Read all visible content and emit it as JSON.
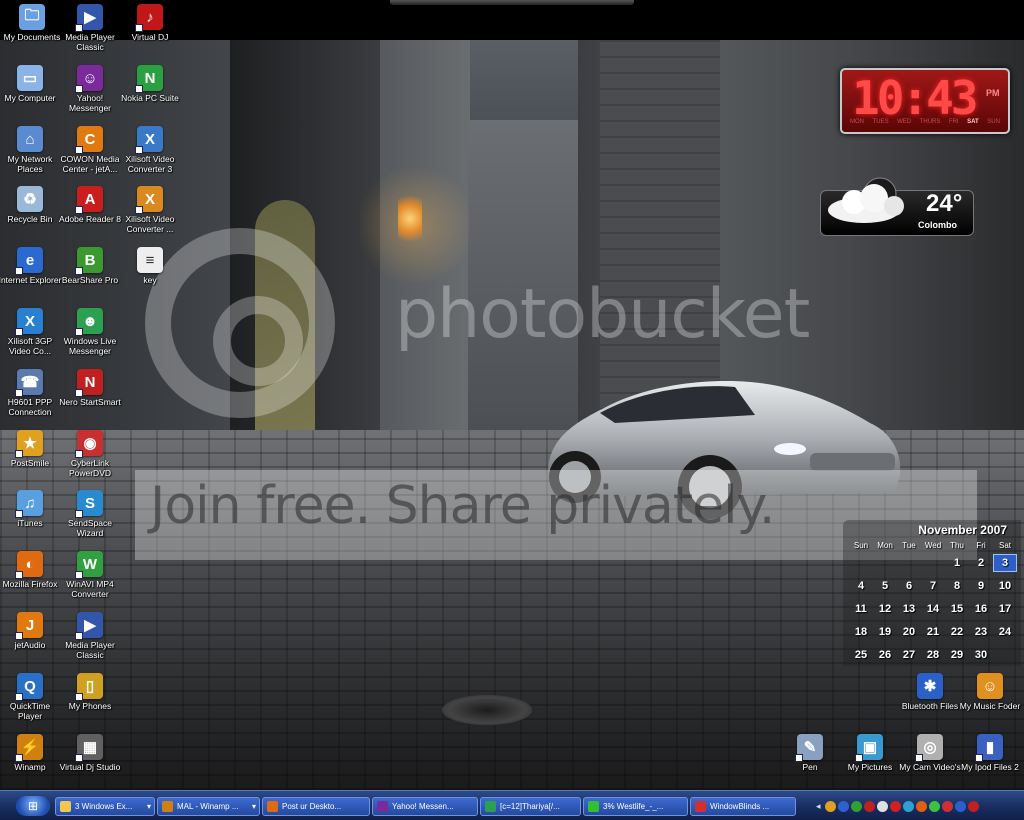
{
  "desktop_icons": [
    {
      "id": "my-documents",
      "label": "My Documents",
      "glyph": "🗀",
      "color": "#6aa0e0"
    },
    {
      "id": "media-player-classic-1",
      "label": "Media Player Classic",
      "glyph": "▶",
      "color": "#3355aa"
    },
    {
      "id": "virtual-dj",
      "label": "Virtual DJ",
      "glyph": "♪",
      "color": "#c01818"
    },
    {
      "id": "my-computer",
      "label": "My Computer",
      "glyph": "▭",
      "color": "#8ab4e8"
    },
    {
      "id": "yahoo-messenger",
      "label": "Yahoo! Messenger",
      "glyph": "☺",
      "color": "#7a2a9a"
    },
    {
      "id": "nokia-pc-suite",
      "label": "Nokia PC Suite",
      "glyph": "N",
      "color": "#2aa040"
    },
    {
      "id": "my-network-places",
      "label": "My Network Places",
      "glyph": "⌂",
      "color": "#5a8ad0"
    },
    {
      "id": "cowon-media-center",
      "label": "COWON Media Center - jetA...",
      "glyph": "C",
      "color": "#e07a10"
    },
    {
      "id": "xilisoft-video-converter-3",
      "label": "Xilisoft Video Converter 3",
      "glyph": "X",
      "color": "#3a78c8"
    },
    {
      "id": "recycle-bin",
      "label": "Recycle Bin",
      "glyph": "♻",
      "color": "#9ab8d8"
    },
    {
      "id": "adobe-reader-8",
      "label": "Adobe Reader 8",
      "glyph": "A",
      "color": "#c81e1e"
    },
    {
      "id": "xilisoft-video-converter",
      "label": "Xilisoft Video Converter ...",
      "glyph": "X",
      "color": "#d88a20"
    },
    {
      "id": "internet-explorer",
      "label": "Internet Explorer",
      "glyph": "e",
      "color": "#2a6ad0"
    },
    {
      "id": "bearshare-pro",
      "label": "BearShare Pro",
      "glyph": "B",
      "color": "#3a9a30"
    },
    {
      "id": "key",
      "label": "key",
      "glyph": "≡",
      "color": "#eeeeee"
    },
    {
      "id": "xilisoft-3gp",
      "label": "Xilisoft 3GP Video Co...",
      "glyph": "X",
      "color": "#2a80d0"
    },
    {
      "id": "windows-live-messenger",
      "label": "Windows Live Messenger",
      "glyph": "☻",
      "color": "#2aa050"
    },
    {
      "id": "h9601-ppp",
      "label": "H9601 PPP Connection",
      "glyph": "☎",
      "color": "#5a7ab0"
    },
    {
      "id": "nero-startsmart",
      "label": "Nero StartSmart",
      "glyph": "N",
      "color": "#c02020"
    },
    {
      "id": "postsmile",
      "label": "PostSmile",
      "glyph": "★",
      "color": "#e0a020"
    },
    {
      "id": "cyberlink-powerdvd",
      "label": "CyberLink PowerDVD",
      "glyph": "◉",
      "color": "#c83030"
    },
    {
      "id": "itunes",
      "label": "iTunes",
      "glyph": "♫",
      "color": "#5aa0e0"
    },
    {
      "id": "sendspace-wizard",
      "label": "SendSpace Wizard",
      "glyph": "S",
      "color": "#2a8ad0"
    },
    {
      "id": "mozilla-firefox",
      "label": "Mozilla Firefox",
      "glyph": "◐",
      "color": "#e06a10"
    },
    {
      "id": "winavi-mp4",
      "label": "WinAVI MP4 Converter",
      "glyph": "W",
      "color": "#30a040"
    },
    {
      "id": "jetaudio",
      "label": "jetAudio",
      "glyph": "J",
      "color": "#e07a10"
    },
    {
      "id": "media-player-classic-2",
      "label": "Media Player Classic",
      "glyph": "▶",
      "color": "#3355aa"
    },
    {
      "id": "quicktime-player",
      "label": "QuickTime Player",
      "glyph": "Q",
      "color": "#2a70c8"
    },
    {
      "id": "my-phones",
      "label": "My Phones",
      "glyph": "▯",
      "color": "#d0a020"
    },
    {
      "id": "winamp",
      "label": "Winamp",
      "glyph": "⚡",
      "color": "#d08010"
    },
    {
      "id": "virtual-dj-studio",
      "label": "Virtual Dj Studio",
      "glyph": "▦",
      "color": "#606060"
    },
    {
      "id": "bluetooth-files",
      "label": "Bluetooth Files",
      "glyph": "✱",
      "color": "#2a60c8"
    },
    {
      "id": "my-music-foder",
      "label": "My Music Foder",
      "glyph": "☺",
      "color": "#e09020"
    },
    {
      "id": "pen",
      "label": "Pen",
      "glyph": "✎",
      "color": "#8aa0c0"
    },
    {
      "id": "my-pictures",
      "label": "My Pictures",
      "glyph": "▣",
      "color": "#3a9ad0"
    },
    {
      "id": "my-cam-videos",
      "label": "My Cam Video's",
      "glyph": "◎",
      "color": "#b0b0b0"
    },
    {
      "id": "my-ipod-files-2",
      "label": "My Ipod Files 2",
      "glyph": "▮",
      "color": "#3a60c0"
    }
  ],
  "watermark": {
    "brand": "photobucket",
    "tagline": "Join free. Share privately."
  },
  "clock": {
    "time": "10:43",
    "ampm": "PM",
    "days": [
      "MON",
      "TUES",
      "WED",
      "THURS",
      "FRI",
      "SAT",
      "SUN"
    ],
    "active_day": "SAT"
  },
  "weather": {
    "temp": "24°",
    "city": "Colombo"
  },
  "calendar": {
    "title": "November 2007",
    "weekdays": [
      "Sun",
      "Mon",
      "Tue",
      "Wed",
      "Thu",
      "Fri",
      "Sat"
    ],
    "weeks": [
      [
        "",
        "",
        "",
        "",
        "1",
        "2",
        "3"
      ],
      [
        "4",
        "5",
        "6",
        "7",
        "8",
        "9",
        "10"
      ],
      [
        "11",
        "12",
        "13",
        "14",
        "15",
        "16",
        "17"
      ],
      [
        "18",
        "19",
        "20",
        "21",
        "22",
        "23",
        "24"
      ],
      [
        "25",
        "26",
        "27",
        "28",
        "29",
        "30",
        ""
      ]
    ],
    "today": "3"
  },
  "taskbar": {
    "start_glyph": "⊞",
    "buttons": [
      {
        "label": "3 Windows Ex...",
        "color": "#f0c850",
        "dropdown": true
      },
      {
        "label": "MAL - Winamp ...",
        "color": "#d08010",
        "dropdown": true
      },
      {
        "label": "Post ur Deskto...",
        "color": "#e06a10",
        "dropdown": false
      },
      {
        "label": "Yahoo! Messen...",
        "color": "#7a2a9a",
        "dropdown": false
      },
      {
        "label": "[c=12]Thariya[/...",
        "color": "#2aa050",
        "dropdown": false
      },
      {
        "label": "3% Westlife_-_...",
        "color": "#30c030",
        "dropdown": false
      },
      {
        "label": "WindowBlinds ...",
        "color": "#d03030",
        "dropdown": false
      }
    ],
    "tray_icons": [
      "#e0a020",
      "#3060d0",
      "#30a030",
      "#c02020",
      "#e0e0e0",
      "#d02020",
      "#30a0d0",
      "#e06010",
      "#40c040",
      "#d03030",
      "#2a60c8",
      "#c02020"
    ]
  }
}
